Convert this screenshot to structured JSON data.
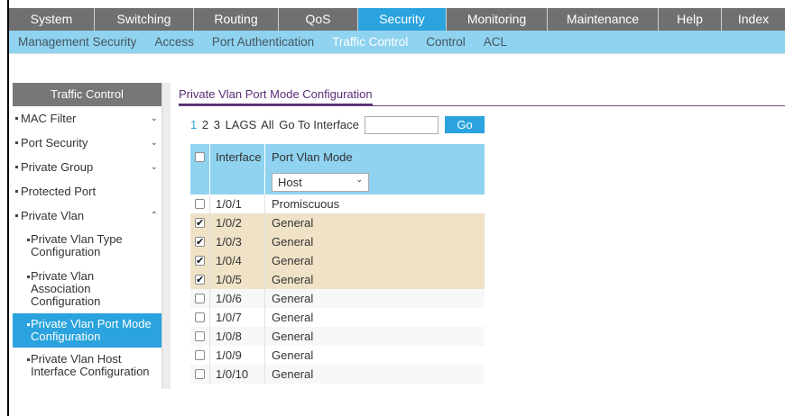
{
  "topnav": [
    {
      "label": "System"
    },
    {
      "label": "Switching"
    },
    {
      "label": "Routing"
    },
    {
      "label": "QoS"
    },
    {
      "label": "Security"
    },
    {
      "label": "Monitoring"
    },
    {
      "label": "Maintenance"
    },
    {
      "label": "Help"
    },
    {
      "label": "Index"
    }
  ],
  "subnav": [
    {
      "label": "Management Security"
    },
    {
      "label": "Access"
    },
    {
      "label": "Port Authentication"
    },
    {
      "label": "Traffic Control"
    },
    {
      "label": "Control"
    },
    {
      "label": "ACL"
    }
  ],
  "sidebar": {
    "title": "Traffic Control",
    "items": [
      {
        "label": "MAC Filter",
        "chevron": "⌄"
      },
      {
        "label": "Port Security",
        "chevron": "⌄"
      },
      {
        "label": "Private Group",
        "chevron": "⌄"
      },
      {
        "label": "Protected Port"
      },
      {
        "label": "Private Vlan",
        "chevron": "⌃"
      }
    ],
    "subitems": [
      {
        "line1": "Private Vlan Type",
        "line2": "Configuration"
      },
      {
        "line1": "Private Vlan",
        "line2": "Association",
        "line3": "Configuration"
      },
      {
        "line1": "Private Vlan Port Mode",
        "line2": "Configuration"
      },
      {
        "line1": "Private Vlan Host",
        "line2": "Interface Configuration"
      }
    ]
  },
  "content": {
    "title": "Private Vlan Port Mode Configuration",
    "pages": [
      "1",
      "2",
      "3",
      "LAGS",
      "All"
    ],
    "goto_label": "Go To Interface",
    "goto_value": "",
    "go_button": "Go"
  },
  "table": {
    "col_interface": "Interface",
    "col_mode": "Port Vlan Mode",
    "mode_filter": "Host",
    "rows": [
      {
        "interface": "1/0/1",
        "mode": "Promiscuous",
        "checked": false
      },
      {
        "interface": "1/0/2",
        "mode": "General",
        "checked": true
      },
      {
        "interface": "1/0/3",
        "mode": "General",
        "checked": true
      },
      {
        "interface": "1/0/4",
        "mode": "General",
        "checked": true
      },
      {
        "interface": "1/0/5",
        "mode": "General",
        "checked": true
      },
      {
        "interface": "1/0/6",
        "mode": "General",
        "checked": false
      },
      {
        "interface": "1/0/7",
        "mode": "General",
        "checked": false
      },
      {
        "interface": "1/0/8",
        "mode": "General",
        "checked": false
      },
      {
        "interface": "1/0/9",
        "mode": "General",
        "checked": false
      },
      {
        "interface": "1/0/10",
        "mode": "General",
        "checked": false
      }
    ]
  },
  "colors": {
    "accent": "#2aa3de",
    "subnav": "#8fd3f0",
    "tab": "#707070",
    "selected_row": "#efe2c7",
    "title": "#5a2d74"
  }
}
